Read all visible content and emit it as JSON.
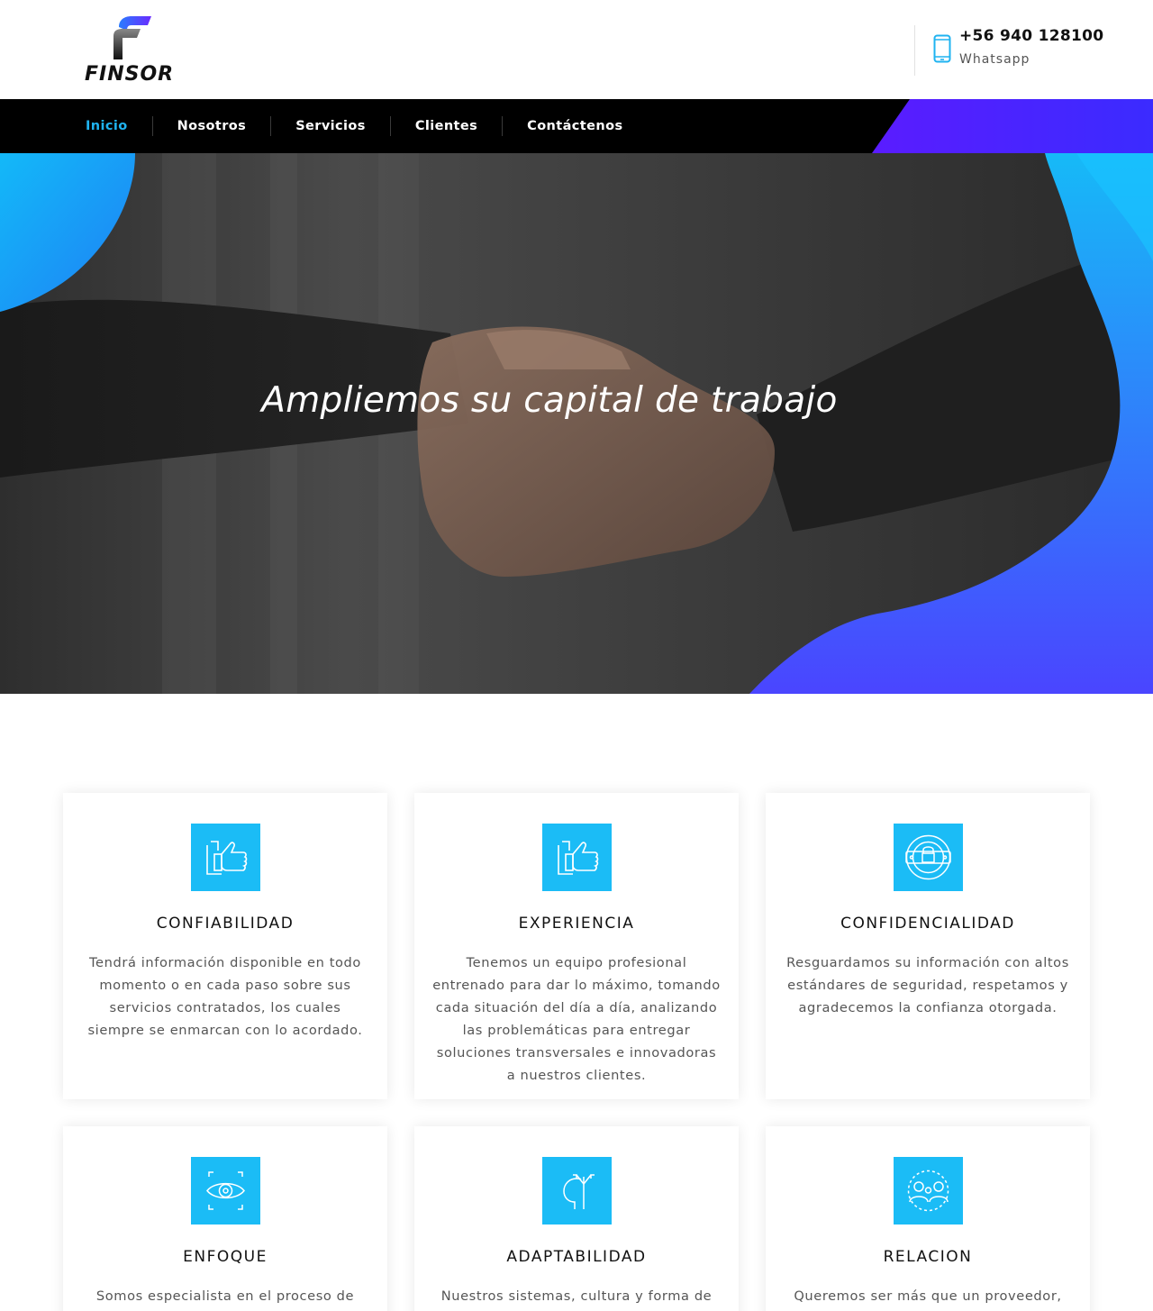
{
  "brand": {
    "name": "FINSOR",
    "accent_color": "#1fb3f0",
    "gradient_start": "#17b6f5",
    "gradient_end": "#4a2bff"
  },
  "header": {
    "phone_number": "+56 940 128100",
    "phone_label": "Whatsapp",
    "phone_icon": "mobile-phone-icon"
  },
  "nav": {
    "items": [
      {
        "label": "Inicio",
        "active": true
      },
      {
        "label": "Nosotros",
        "active": false
      },
      {
        "label": "Servicios",
        "active": false
      },
      {
        "label": "Clientes",
        "active": false
      },
      {
        "label": "Contáctenos",
        "active": false
      }
    ]
  },
  "hero": {
    "title": "Ampliemos su capital de trabajo",
    "image": "handshake-photo"
  },
  "features": [
    {
      "icon": "thumbs-up-icon",
      "title": "CONFIABILIDAD",
      "text": "Tendrá información disponible en todo momento o en cada paso sobre sus servicios contratados, los cuales siempre se enmarcan con lo acordado."
    },
    {
      "icon": "thumbs-up-icon",
      "title": "EXPERIENCIA",
      "text": "Tenemos un equipo profesional entrenado para dar lo máximo, tomando cada situación del día a día, analizando las problemáticas para entregar soluciones transversales e innovadoras a nuestros clientes."
    },
    {
      "icon": "lock-shield-icon",
      "title": "CONFIDENCIALIDAD",
      "text": "Resguardamos su información con altos estándares de seguridad, respetamos y agradecemos la confianza otorgada."
    },
    {
      "icon": "eye-focus-icon",
      "title": "ENFOQUE",
      "text": "Somos especialista en el proceso de"
    },
    {
      "icon": "head-arrows-icon",
      "title": "ADAPTABILIDAD",
      "text": "Nuestros sistemas, cultura y forma de"
    },
    {
      "icon": "people-relation-icon",
      "title": "RELACION",
      "text": "Queremos ser más que un proveedor,"
    }
  ]
}
